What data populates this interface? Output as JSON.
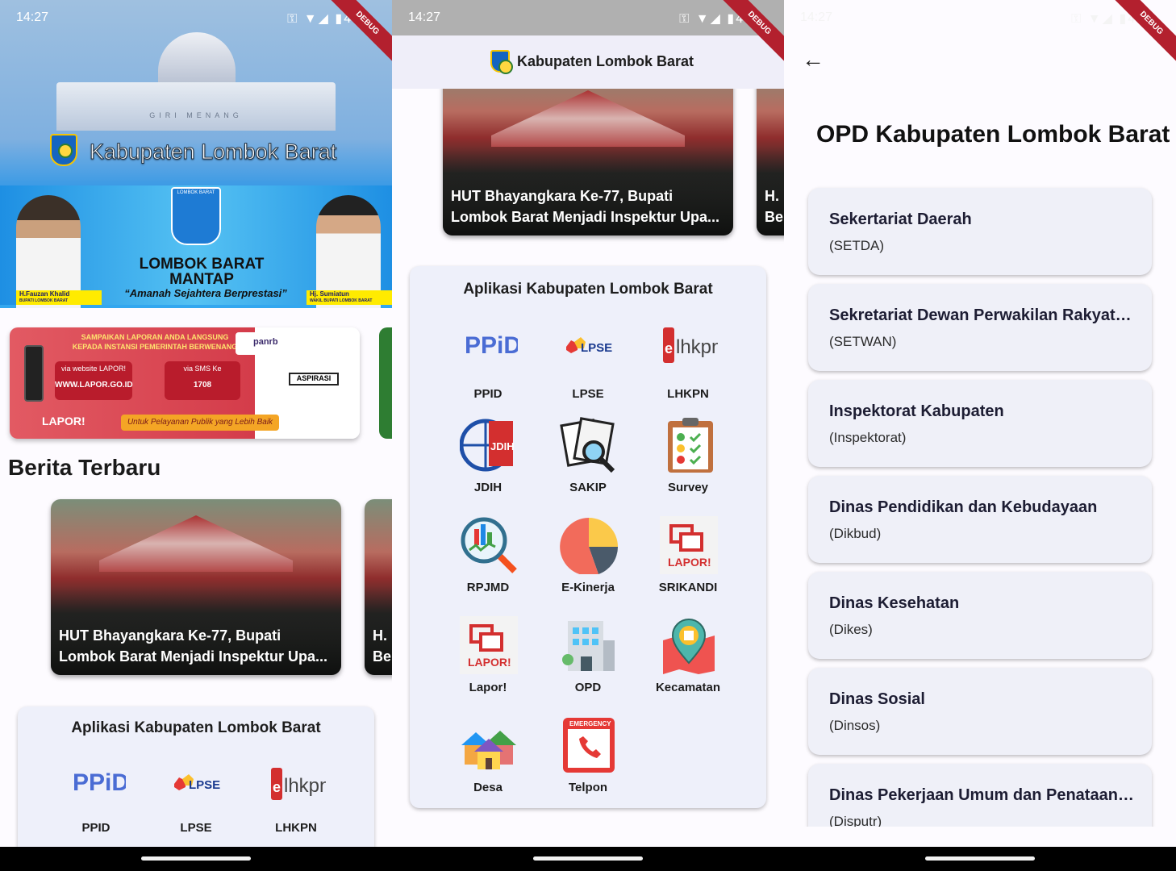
{
  "status": {
    "time": "14:27",
    "battery": "46"
  },
  "debug_banner": "DEBUG",
  "screen1": {
    "hero_title": "Kabupaten Lombok Barat",
    "building_text": "GIRI MENANG",
    "badge_text": "LOMBOK BARAT",
    "banner_line1": "LOMBOK BARAT",
    "banner_line2": "MANTAP",
    "banner_slogan": "“Amanah Sejahtera Berprestasi”",
    "left_name": "H.Fauzan Khalid",
    "left_role": "BUPATI LOMBOK BARAT",
    "right_name": "Hj. Sumiatun",
    "right_role": "WAKIL BUPATI LOMBOK BARAT",
    "lapor_banner": {
      "headline1": "SAMPAIKAN LAPORAN ANDA LANGSUNG",
      "headline2": "KEPADA INSTANSI PEMERINTAH BERWENANG",
      "via_web": "via website LAPOR!",
      "web_url": "WWW.LAPOR.GO.ID",
      "via_sms": "via SMS Ke",
      "sms_number": "1708",
      "brand": "LAPOR!",
      "tagline": "Untuk Pelayanan Publik yang Lebih Baik",
      "aspirasi": "ASPIRASI",
      "panrb": "panrb"
    },
    "section_title": "Berita Terbaru",
    "news_line1": "HUT Bhayangkara Ke-77, Bupati",
    "news_line2": "Lombok Barat Menjadi Inspektur Upa...",
    "news_peek_line1": "H.",
    "news_peek_line2": "Be",
    "apps_title": "Aplikasi Kabupaten Lombok Barat"
  },
  "screen2": {
    "title": "Kabupaten Lombok Barat",
    "news_line1": "HUT Bhayangkara Ke-77, Bupati",
    "news_line2": "Lombok Barat Menjadi Inspektur Upa...",
    "news_peek_line1": "H.",
    "news_peek_line2": "Be",
    "apps_title": "Aplikasi Kabupaten Lombok Barat",
    "apps": [
      {
        "label": "PPID",
        "icon": "ppid-icon"
      },
      {
        "label": "LPSE",
        "icon": "lpse-icon"
      },
      {
        "label": "LHKPN",
        "icon": "elhkpn-icon"
      },
      {
        "label": "JDIH",
        "icon": "jdih-globe-icon"
      },
      {
        "label": "SAKIP",
        "icon": "documents-magnifier-icon"
      },
      {
        "label": "Survey",
        "icon": "clipboard-survey-icon"
      },
      {
        "label": "RPJMD",
        "icon": "chart-magnifier-icon"
      },
      {
        "label": "E-Kinerja",
        "icon": "pie-chart-icon"
      },
      {
        "label": "SRIKANDI",
        "icon": "lapor-chat-icon"
      },
      {
        "label": "Lapor!",
        "icon": "lapor-chat-icon"
      },
      {
        "label": "OPD",
        "icon": "office-building-icon"
      },
      {
        "label": "Kecamatan",
        "icon": "map-pin-icon"
      },
      {
        "label": "Desa",
        "icon": "houses-icon"
      },
      {
        "label": "Telpon",
        "icon": "emergency-phone-icon"
      }
    ]
  },
  "screen3": {
    "title": "OPD Kabupaten Lombok Barat",
    "opd": [
      {
        "name": "Sekertariat Daerah",
        "abbr": "(SETDA)"
      },
      {
        "name": "Sekretariat Dewan Perwakilan Rakyat Daerah",
        "abbr": "(SETWAN)"
      },
      {
        "name": "Inspektorat Kabupaten",
        "abbr": "(Inspektorat)"
      },
      {
        "name": "Dinas Pendidikan dan Kebudayaan",
        "abbr": "(Dikbud)"
      },
      {
        "name": "Dinas Kesehatan",
        "abbr": "(Dikes)"
      },
      {
        "name": "Dinas Sosial",
        "abbr": "(Dinsos)"
      },
      {
        "name": "Dinas Pekerjaan Umum dan Penataan Ruang",
        "abbr": "(Disputr)"
      }
    ]
  },
  "colors": {
    "card_bg": "#eef0fa",
    "page_bg": "#fdfbff",
    "debug": "#b3202e"
  }
}
